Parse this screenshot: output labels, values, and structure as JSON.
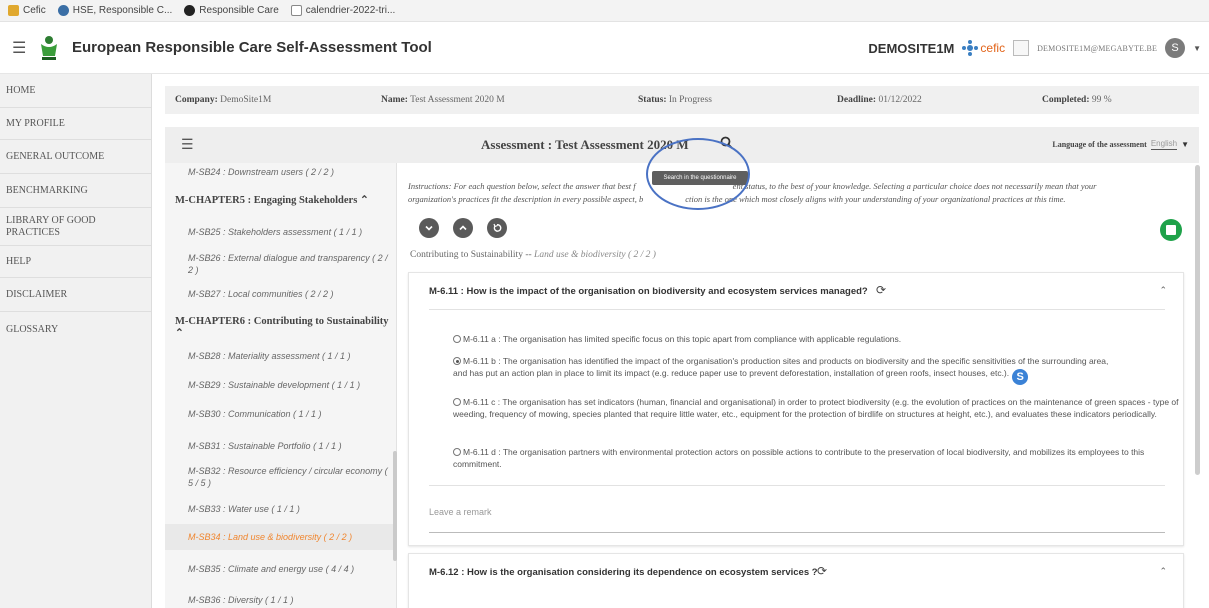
{
  "bookmarks": [
    {
      "label": "Cefic",
      "color": "#e0a82e"
    },
    {
      "label": "HSE, Responsible C...",
      "color": "#3a6ea5"
    },
    {
      "label": "Responsible Care",
      "color": "#222222"
    },
    {
      "label": "calendrier-2022-tri...",
      "color": "#ffffff"
    }
  ],
  "header": {
    "app_title": "European Responsible Care Self-Assessment Tool",
    "site": "DEMOSITE1M",
    "brand": "cefic",
    "email": "DEMOSITE1M@MEGABYTE.BE",
    "avatar_letter": "S"
  },
  "sidebar": {
    "items": [
      "HOME",
      "MY PROFILE",
      "GENERAL OUTCOME",
      "BENCHMARKING",
      "LIBRARY OF GOOD PRACTICES",
      "HELP",
      "DISCLAIMER",
      "GLOSSARY"
    ]
  },
  "infobar": {
    "company_label": "Company:",
    "company": "DemoSite1M",
    "name_label": "Name:",
    "name": "Test Assessment 2020 M",
    "status_label": "Status:",
    "status": "In Progress",
    "deadline_label": "Deadline:",
    "deadline": "01/12/2022",
    "completed_label": "Completed:",
    "completed": "99 %"
  },
  "assessment": {
    "title": "Assessment : Test Assessment 2020 M",
    "language_label": "Language of the assessment",
    "language": "English",
    "tooltip": "Search in the questionnaire"
  },
  "chapters": {
    "sb24": "M-SB24 : Downstream users ( 2 / 2 )",
    "ch5": "M-CHAPTER5 : Engaging Stakeholders",
    "sb25": "M-SB25 : Stakeholders assessment ( 1 / 1 )",
    "sb26": "M-SB26 : External dialogue and transparency ( 2 / 2 )",
    "sb27": "M-SB27 : Local communities ( 2 / 2 )",
    "ch6": "M-CHAPTER6 : Contributing to Sustainability",
    "sb28": "M-SB28 : Materiality assessment ( 1 / 1 )",
    "sb29": "M-SB29 : Sustainable development ( 1 / 1 )",
    "sb30": "M-SB30 : Communication ( 1 / 1 )",
    "sb31": "M-SB31 : Sustainable Portfolio ( 1 / 1 )",
    "sb32": "M-SB32 : Resource efficiency / circular economy ( 5 / 5 )",
    "sb33": "M-SB33 : Water use ( 1 / 1 )",
    "sb34": "M-SB34 : Land use & biodiversity ( 2 / 2 )",
    "sb35": "M-SB35 : Climate and energy use ( 4 / 4 )",
    "sb36": "M-SB36 : Diversity ( 1 / 1 )"
  },
  "main": {
    "instructions_a": "Instructions: For each question below, select the answer that best f",
    "instructions_b": "ent status, to the best of your knowledge. Selecting a particular choice does not necessarily mean that your",
    "instructions_c": "organization's practices fit the description in every possible aspect, b",
    "instructions_d": "ction is the one which most closely aligns with your understanding of your organizational practices at this time.",
    "breadcrumb_chapter": "Contributing to Sustainability --",
    "breadcrumb_section": "Land use & biodiversity ( 2 / 2 )",
    "q1_title": "M-6.11 : How is the impact of the organisation on biodiversity and ecosystem services managed?",
    "q1_opt_a": "M-6.11 a : The organisation has limited specific focus on this topic apart from compliance with applicable regulations.",
    "q1_opt_b1": "M-6.11 b : The organisation has identified the impact of the organisation's production sites and products on biodiversity and the specific sensitivities of the surrounding area,",
    "q1_opt_b2": "and has put an action plan in place to limit its impact (e.g. reduce paper use to prevent deforestation, installation of green roofs, insect houses, etc.).",
    "q1_opt_c": "M-6.11 c : The organisation has set indicators (human, financial and organisational) in order to protect biodiversity (e.g. the evolution of practices on the maintenance of green spaces - type of weeding, frequency of mowing, species planted that require little water, etc., equipment for the protection of birdlife on structures at height, etc.), and evaluates these indicators periodically.",
    "q1_opt_d": "M-6.11 d : The organisation partners with environmental protection actors on possible actions to contribute to the preservation of local biodiversity, and mobilizes its employees to this commitment.",
    "remark_placeholder": "Leave a remark",
    "q2_title": "M-6.12 : How is the organisation considering its dependence on ecosystem services ?"
  },
  "colors": {
    "accent_orange": "#f0862f",
    "save_green": "#1fa24a",
    "annotation_blue": "#4a72c4"
  }
}
